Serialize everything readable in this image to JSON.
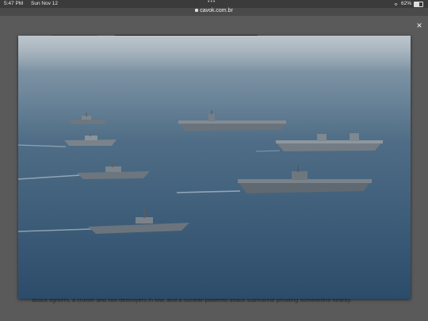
{
  "status_bar": {
    "time": "5:47 PM",
    "date": "Sun Nov 12",
    "multitask_dots": "•••",
    "battery_percent": "62%",
    "battery_level": 0.62,
    "icons": [
      "wifi-icon",
      "battery-icon"
    ]
  },
  "browser": {
    "url": "cavok.com.br",
    "url_icon": "lock-icon"
  },
  "lightbox": {
    "close_label": "×",
    "photo_alt": "Naval fleet formation at sea"
  },
  "background_page": {
    "caption_text": "attack fighters, a cruiser and two destroyers in tow, and a nuclear-powered attack submarine prowling somewhere nearby."
  },
  "colors": {
    "overlay": "#4a4a4a",
    "sea_top": "#8fa0ae",
    "sea_bottom": "#2f4f6e",
    "ship_hull": "#7c858d"
  }
}
